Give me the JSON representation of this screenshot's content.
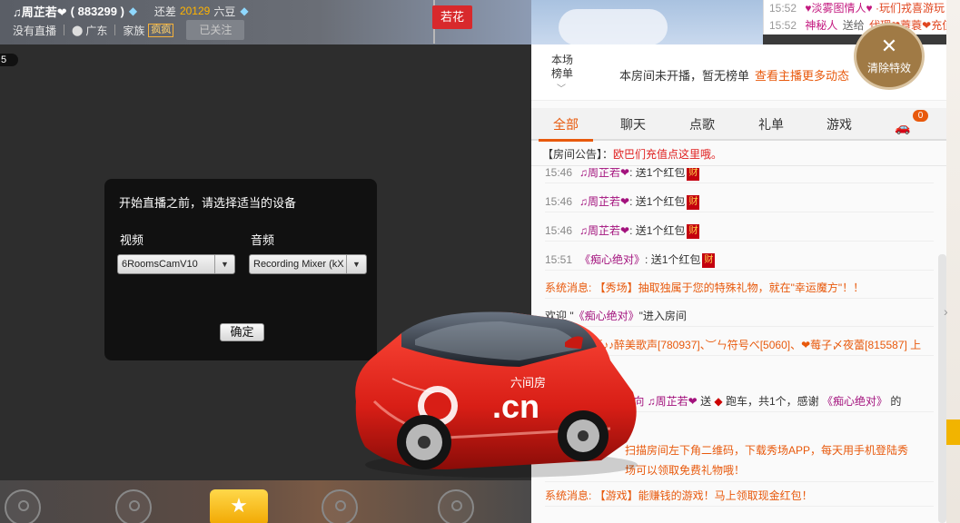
{
  "topbar": {
    "anchor_name": "♫周芷若❤",
    "anchor_id": "( 883299 )",
    "gap_label": "还差",
    "gap_value": "20129",
    "gap_unit": "六豆",
    "live_status": "没有直播",
    "location": "广东",
    "family_label": "家族",
    "family_tag": "疯疯",
    "follow_button": "已关注"
  },
  "flag_text": "若花",
  "ticker": [
    {
      "time": "15:52",
      "user": "♥淡雾图情人♥",
      "send": "",
      "gift": "·玩们戎喜游玩"
    },
    {
      "time": "15:52",
      "user": "神秘人",
      "send": "送给",
      "gift": "代理❤蓑蓑❤充值"
    }
  ],
  "video": {
    "viewer_count": "5"
  },
  "device_dialog": {
    "title": "开始直播之前，请选择适当的设备",
    "video_label": "视频",
    "audio_label": "音频",
    "video_device": "6RoomsCamV10",
    "audio_device": "Recording Mixer (kX",
    "confirm": "确定"
  },
  "rank": {
    "label": "本场榜单",
    "message": "本房间未开播，暂无榜单",
    "link": "查看主播更多动态"
  },
  "clear_effects": "清除特效",
  "tabs": [
    {
      "label": "全部",
      "active": true
    },
    {
      "label": "聊天",
      "active": false
    },
    {
      "label": "点歌",
      "active": false
    },
    {
      "label": "礼单",
      "active": false
    },
    {
      "label": "游戏",
      "active": false
    }
  ],
  "car_count": "0",
  "notice": {
    "label": "【房间公告】：",
    "text": "欧巴们充值点这里哦。"
  },
  "chat": [
    {
      "time": "15:46",
      "user": "♫周芷若❤",
      "text": ": 送1个红包",
      "icon": "财"
    },
    {
      "time": "15:46",
      "user": "♫周芷若❤",
      "text": ": 送1个红包",
      "icon": "财"
    },
    {
      "time": "15:46",
      "user": "♫周芷若❤",
      "text": ": 送1个红包",
      "icon": "财"
    },
    {
      "time": "15:51",
      "user": "《痴心绝对》",
      "text": ": 送1个红包",
      "icon": "财"
    }
  ],
  "system_show": "系统消息: 【秀场】抽取独属于您的特殊礼物，就在\"幸运魔方\"！！",
  "welcome": {
    "prefix": "欢迎 \"",
    "user": "《痴心绝对》",
    "suffix": "\"进入房间"
  },
  "multi_users": "小妖♪♪醉美歌声[780937]、︶ㄣ符号べ[5060]、❤莓子〆夜蕾[815587] 上",
  "thanks_line": {
    "part1": "对》 向 ",
    "user": "♫周芷若❤",
    "part2": " 送 ",
    "part3": " 跑车，共1个，感谢 ",
    "user2": "《痴心绝对》",
    "part4": " 的"
  },
  "app_promo_1": "扫描房间左下角二维码，下载秀场APP，每天用手机登陆秀",
  "app_promo_2": "场可以领取免费礼物哦！",
  "system_game": "系统消息: 【游戏】能赚钱的游戏！马上领取现金红包！",
  "car_overlay": {
    "brand": ".cn",
    "brand_small": "六间房"
  }
}
